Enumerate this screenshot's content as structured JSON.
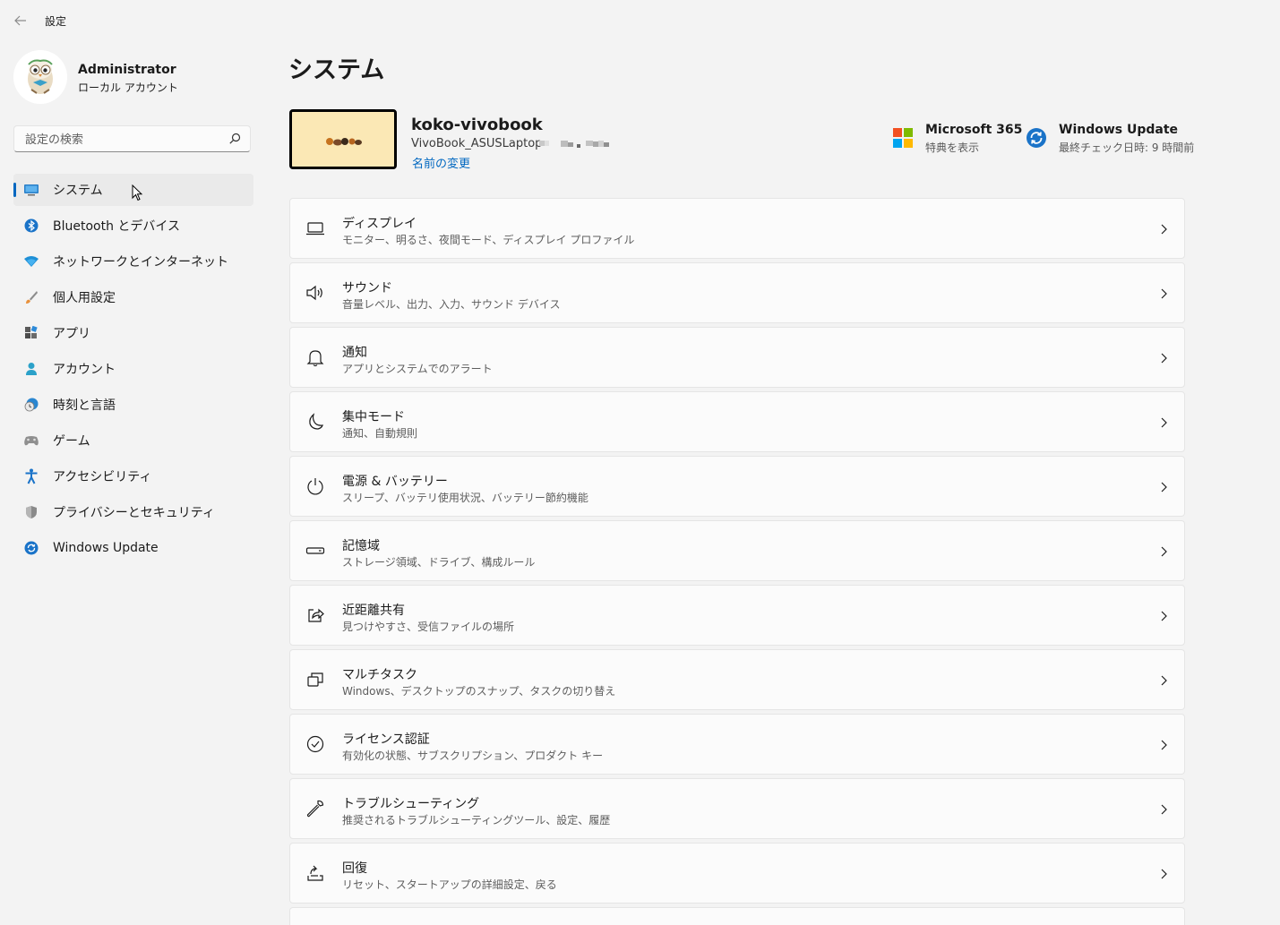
{
  "window": {
    "title": "設定",
    "back_icon": "back-arrow-icon"
  },
  "user": {
    "name": "Administrator",
    "account_type": "ローカル アカウント"
  },
  "search": {
    "placeholder": "設定の検索",
    "value": ""
  },
  "sidebar": {
    "items": [
      {
        "label": "システム",
        "icon": "system-icon",
        "active": true
      },
      {
        "label": "Bluetooth とデバイス",
        "icon": "bluetooth-icon"
      },
      {
        "label": "ネットワークとインターネット",
        "icon": "wifi-icon"
      },
      {
        "label": "個人用設定",
        "icon": "brush-icon"
      },
      {
        "label": "アプリ",
        "icon": "apps-icon"
      },
      {
        "label": "アカウント",
        "icon": "person-icon"
      },
      {
        "label": "時刻と言語",
        "icon": "clock-globe-icon"
      },
      {
        "label": "ゲーム",
        "icon": "gamepad-icon"
      },
      {
        "label": "アクセシビリティ",
        "icon": "accessibility-icon"
      },
      {
        "label": "プライバシーとセキュリティ",
        "icon": "shield-icon"
      },
      {
        "label": "Windows Update",
        "icon": "windows-update-icon"
      }
    ]
  },
  "page": {
    "title": "システム"
  },
  "device": {
    "name": "koko-vivobook",
    "model": "VivoBook_ASUSLaptop",
    "rename_link": "名前の変更"
  },
  "quick_links": {
    "microsoft365": {
      "title": "Microsoft 365",
      "subtitle": "特典を表示"
    },
    "windows_update": {
      "title": "Windows Update",
      "subtitle": "最終チェック日時: 9 時間前"
    }
  },
  "settings": [
    {
      "title": "ディスプレイ",
      "subtitle": "モニター、明るさ、夜間モード、ディスプレイ プロファイル",
      "icon": "display-icon"
    },
    {
      "title": "サウンド",
      "subtitle": "音量レベル、出力、入力、サウンド デバイス",
      "icon": "speaker-icon"
    },
    {
      "title": "通知",
      "subtitle": "アプリとシステムでのアラート",
      "icon": "bell-icon"
    },
    {
      "title": "集中モード",
      "subtitle": "通知、自動規則",
      "icon": "moon-icon"
    },
    {
      "title": "電源 & バッテリー",
      "subtitle": "スリープ、バッテリ使用状況、バッテリー節約機能",
      "icon": "power-icon"
    },
    {
      "title": "記憶域",
      "subtitle": "ストレージ領域、ドライブ、構成ルール",
      "icon": "storage-icon"
    },
    {
      "title": "近距離共有",
      "subtitle": "見つけやすさ、受信ファイルの場所",
      "icon": "share-icon"
    },
    {
      "title": "マルチタスク",
      "subtitle": "Windows、デスクトップのスナップ、タスクの切り替え",
      "icon": "multitask-icon"
    },
    {
      "title": "ライセンス認証",
      "subtitle": "有効化の状態、サブスクリプション、プロダクト キー",
      "icon": "check-circle-icon"
    },
    {
      "title": "トラブルシューティング",
      "subtitle": "推奨されるトラブルシューティングツール、設定、履歴",
      "icon": "wrench-icon"
    },
    {
      "title": "回復",
      "subtitle": "リセット、スタートアップの詳細設定、戻る",
      "icon": "recovery-icon"
    }
  ]
}
